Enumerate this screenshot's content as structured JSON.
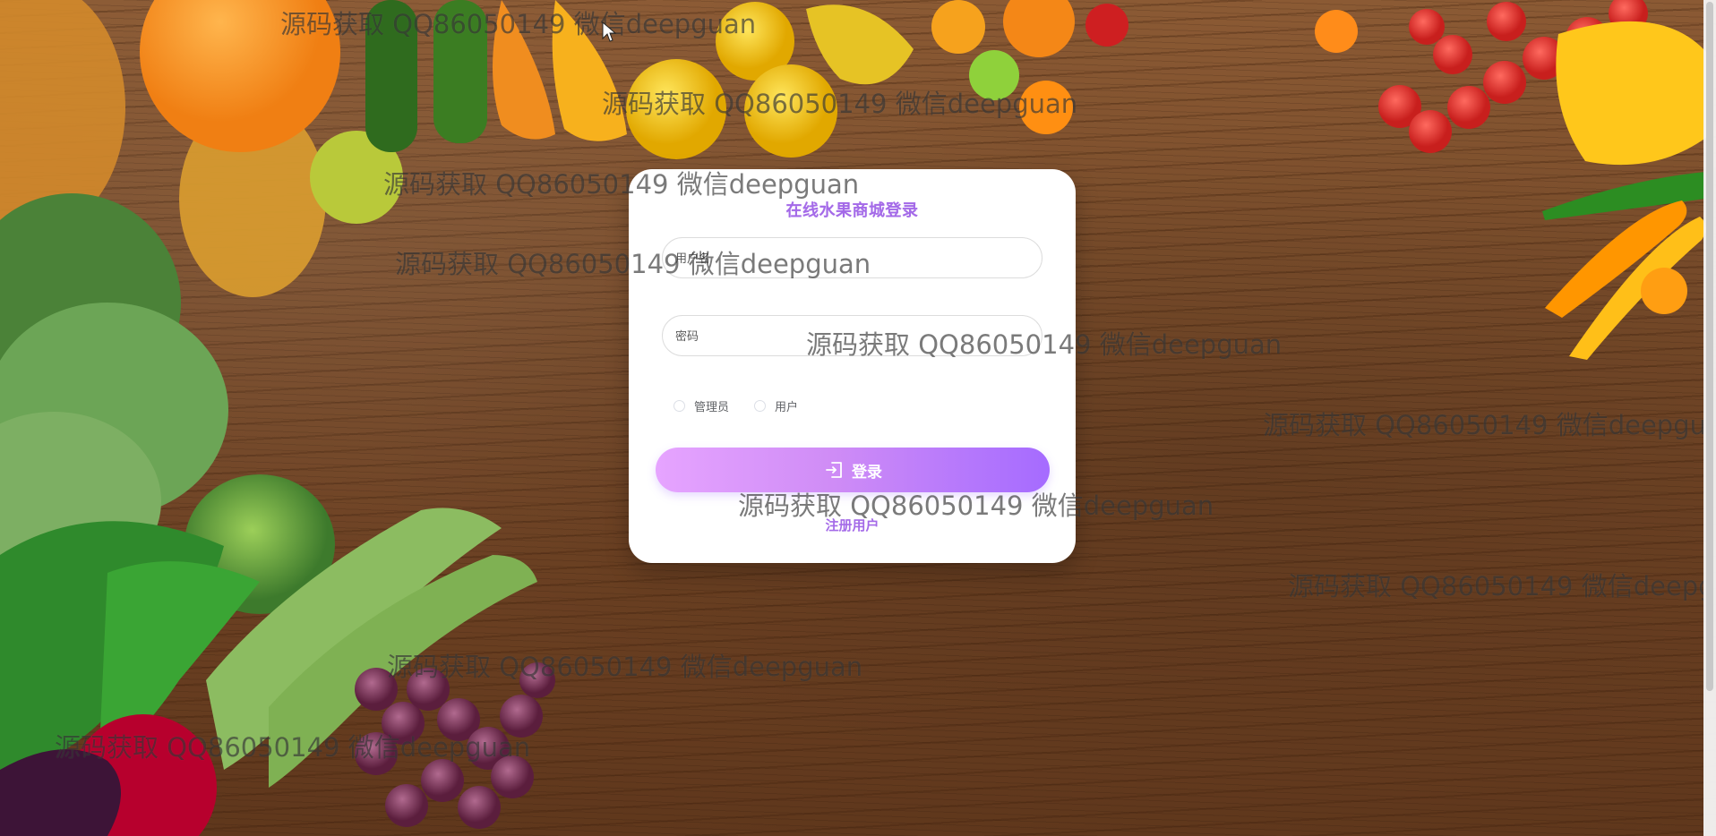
{
  "login": {
    "title": "在线水果商城登录",
    "username_placeholder": "用户名",
    "password_placeholder": "密码",
    "roles": [
      "管理员",
      "用户"
    ],
    "login_label": "登录",
    "register_label": "注册用户"
  },
  "colors": {
    "accent": "#a46ae8",
    "button_start": "#e6a4ff",
    "button_end": "#a56bff"
  },
  "watermarks": [
    "源码获取 QQ86050149 微信deepguan",
    "源码获取 QQ86050149 微信deepguan",
    "源码获取 QQ86050149 微信deepguan",
    "源码获取 QQ86050149 微信deepguan",
    "源码获取 QQ86050149 微信deepguan",
    "源码获取 QQ86050149 微信deepgua",
    "源码获取 QQ86050149 微信deepguan",
    "源码获取 QQ86050149 微信deepg",
    "源码获取 QQ86050149 微信deepguan",
    "源码获取 QQ86050149 微信deepguan"
  ],
  "icons": {
    "login": "login-icon",
    "cursor": "mouse-pointer-icon"
  }
}
